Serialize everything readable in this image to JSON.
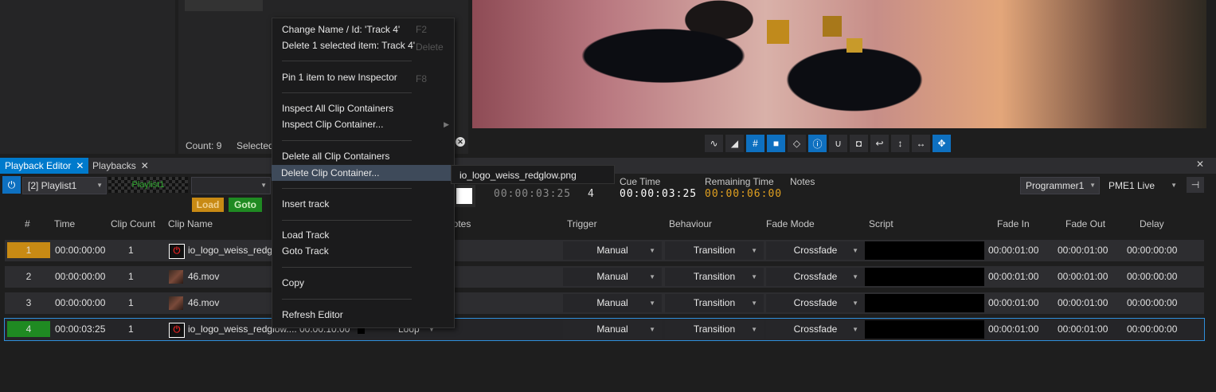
{
  "top_panel": {
    "count_label": "Count: 9",
    "selected_label": "Selected"
  },
  "preview_toolbar": {
    "icons": [
      "waveform-icon",
      "gradient-icon",
      "grid-icon",
      "camera-icon",
      "erase-icon",
      "info-icon",
      "magnet-icon",
      "snapshot-icon",
      "undo-icon",
      "fit-height-icon",
      "fit-width-icon",
      "move-icon"
    ]
  },
  "tabs": {
    "playback_editor": "Playback Editor",
    "playbacks": "Playbacks",
    "close": "✕"
  },
  "controls": {
    "playlist": "[2] Playlist1",
    "playlist_preview": "Playlist1",
    "load": "Load",
    "goto": "Goto",
    "current_time": "00:00:03:25",
    "current_index": "4",
    "cue_time_label": "Cue Time",
    "cue_time": "00:00:03:25",
    "remaining_time_label": "Remaining Time",
    "remaining_time": "00:00:06:00",
    "notes_label": "Notes",
    "programmer": "Programmer1",
    "pme": "PME1 Live"
  },
  "columns": {
    "num": "#",
    "time": "Time",
    "clip_count": "Clip Count",
    "clip_name": "Clip Name",
    "notes": "Notes",
    "trigger": "Trigger",
    "behaviour": "Behaviour",
    "fade_mode": "Fade Mode",
    "script": "Script",
    "fade_in": "Fade In",
    "fade_out": "Fade Out",
    "delay": "Delay"
  },
  "rows": [
    {
      "num": "1",
      "time": "00:00:00:00",
      "clip_count": "1",
      "clip_name": "io_logo_weiss_redgl",
      "duration": "",
      "end": "",
      "trigger": "Manual",
      "behaviour": "Transition",
      "fade_mode": "Crossfade",
      "fade_in": "00:00:01:00",
      "fade_out": "00:00:01:00",
      "delay": "00:00:00:00"
    },
    {
      "num": "2",
      "time": "00:00:00:00",
      "clip_count": "1",
      "clip_name": "46.mov",
      "duration": "",
      "end": "",
      "trigger": "Manual",
      "behaviour": "Transition",
      "fade_mode": "Crossfade",
      "fade_in": "00:00:01:00",
      "fade_out": "00:00:01:00",
      "delay": "00:00:00:00"
    },
    {
      "num": "3",
      "time": "00:00:00:00",
      "clip_count": "1",
      "clip_name": "46.mov",
      "duration": "",
      "end": "",
      "trigger": "Manual",
      "behaviour": "Transition",
      "fade_mode": "Crossfade",
      "fade_in": "00:00:01:00",
      "fade_out": "00:00:01:00",
      "delay": "00:00:00:00"
    },
    {
      "num": "4",
      "time": "00:00:03:25",
      "clip_count": "1",
      "clip_name": "io_logo_weiss_redglow....",
      "duration": "00:00:10:00",
      "end": "Loop",
      "trigger": "Manual",
      "behaviour": "Transition",
      "fade_mode": "Crossfade",
      "fade_in": "00:00:01:00",
      "fade_out": "00:00:01:00",
      "delay": "00:00:00:00"
    }
  ],
  "context_menu": {
    "change_name": "Change Name / Id: 'Track 4'",
    "change_name_shortcut": "F2",
    "delete_selected": "Delete 1 selected item: Track 4'",
    "delete_shortcut": "Delete",
    "pin_inspector": "Pin 1 item to new Inspector",
    "pin_shortcut": "F8",
    "inspect_all": "Inspect All Clip Containers",
    "inspect_one": "Inspect Clip Container...",
    "delete_all": "Delete all Clip Containers",
    "delete_one": "Delete Clip Container...",
    "insert_track": "Insert track",
    "load_track": "Load Track",
    "goto_track": "Goto Track",
    "copy": "Copy",
    "refresh": "Refresh Editor"
  },
  "submenu": {
    "item": "io_logo_weiss_redglow.png"
  },
  "colors": {
    "accent": "#007acc",
    "load": "#c88a14",
    "goto": "#1f8a22",
    "row1_num": "#c88a14",
    "row4_num": "#1f8a22",
    "remaining": "#e0a020"
  }
}
